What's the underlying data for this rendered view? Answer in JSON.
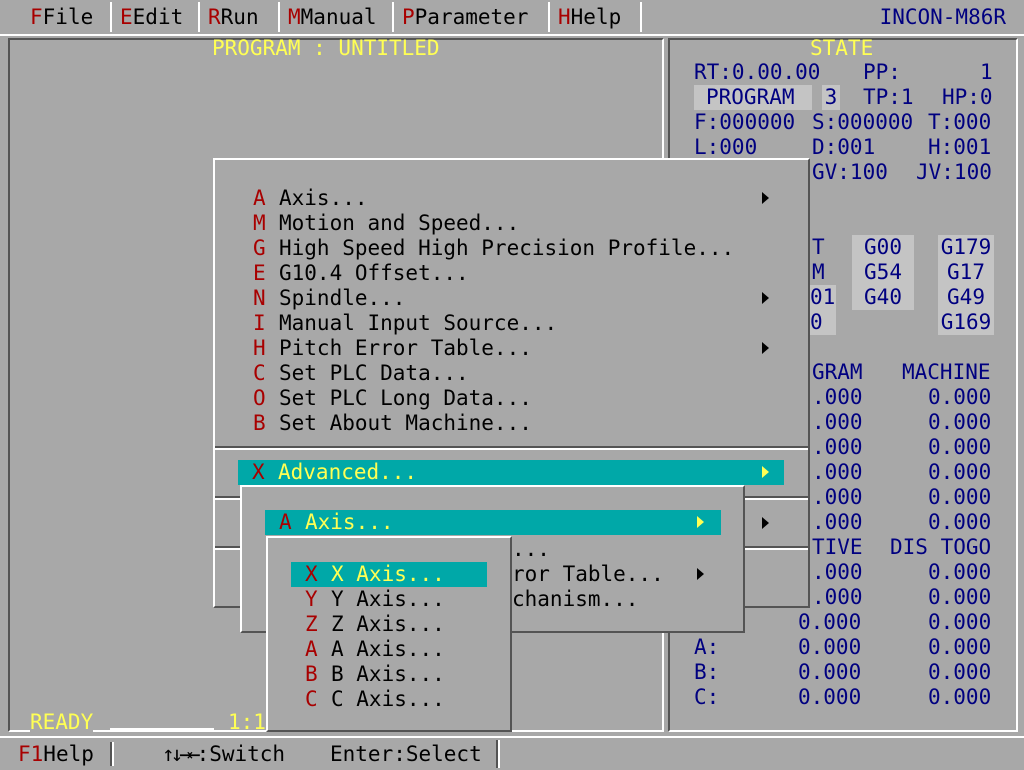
{
  "menubar": {
    "items": [
      {
        "key": "F",
        "label": "File"
      },
      {
        "key": "E",
        "label": "Edit"
      },
      {
        "key": "R",
        "label": "Run"
      },
      {
        "key": "M",
        "label": "Manual"
      },
      {
        "key": "P",
        "label": "Parameter"
      },
      {
        "key": "H",
        "label": "Help"
      }
    ],
    "brand": "INCON-M86R"
  },
  "program": {
    "title": "PROGRAM : UNTITLED",
    "status": "READY",
    "ratio": "1:1"
  },
  "state": {
    "title": "STATE",
    "rt": "RT:0.00.00",
    "pp": "PP:",
    "pp_val": "1",
    "mode": "PROGRAM",
    "mode_num": "3",
    "tp": "TP:1",
    "hp": "HP:0",
    "f": "F:000000",
    "s": "S:000000",
    "t": "T:000",
    "l": "L:000",
    "d": "D:001",
    "h": "H:001",
    "gv": "GV:100",
    "jv": "JV:100",
    "gcodes": [
      [
        "T",
        "G00",
        "G179"
      ],
      [
        "M",
        "G54",
        "G17"
      ],
      [
        "01",
        "G40",
        "G49"
      ],
      [
        "0",
        "",
        "G169"
      ]
    ],
    "coord_headers": [
      "GRAM",
      "MACHINE"
    ],
    "coords1": [
      [
        ".000",
        "0.000"
      ],
      [
        ".000",
        "0.000"
      ],
      [
        ".000",
        "0.000"
      ],
      [
        ".000",
        "0.000"
      ],
      [
        ".000",
        "0.000"
      ],
      [
        ".000",
        "0.000"
      ]
    ],
    "coord_headers2": [
      "TIVE",
      "DIS TOGO"
    ],
    "coords2": [
      {
        "axis": "",
        "rel": ".000",
        "dis": "0.000"
      },
      {
        "axis": "",
        "rel": ".000",
        "dis": "0.000"
      },
      {
        "axis": "",
        "rel": "0.000",
        "dis": "0.000"
      },
      {
        "axis": "A:",
        "rel": "0.000",
        "dis": "0.000"
      },
      {
        "axis": "B:",
        "rel": "0.000",
        "dis": "0.000"
      },
      {
        "axis": "C:",
        "rel": "0.000",
        "dis": "0.000"
      }
    ]
  },
  "menu1": {
    "items": [
      {
        "key": "A",
        "label": "Axis...",
        "sub": true
      },
      {
        "key": "M",
        "label": "Motion and Speed..."
      },
      {
        "key": "G",
        "label": "High Speed High Precision Profile..."
      },
      {
        "key": "E",
        "label": "G10.4 Offset..."
      },
      {
        "key": "N",
        "label": "Spindle...",
        "sub": true
      },
      {
        "key": "I",
        "label": "Manual Input Source..."
      },
      {
        "key": "H",
        "label": "Pitch Error Table...",
        "sub": true
      },
      {
        "key": "C",
        "label": "Set PLC Data..."
      },
      {
        "key": "O",
        "label": "Set PLC Long Data..."
      },
      {
        "key": "B",
        "label": "Set About Machine..."
      }
    ],
    "advanced": {
      "key": "X",
      "label": "Advanced..."
    }
  },
  "menu2": {
    "selected": {
      "key": "A",
      "label": "Axis..."
    },
    "partial": [
      "...",
      "ror Table...",
      "chanism..."
    ]
  },
  "menu3": {
    "items": [
      {
        "key": "X",
        "label": "X Axis..."
      },
      {
        "key": "Y",
        "label": "Y Axis..."
      },
      {
        "key": "Z",
        "label": "Z Axis..."
      },
      {
        "key": "A",
        "label": "A Axis..."
      },
      {
        "key": "B",
        "label": "B Axis..."
      },
      {
        "key": "C",
        "label": "C Axis..."
      }
    ]
  },
  "statusbar": {
    "f1_key": "F1",
    "f1_label": "Help",
    "arrows": "↑↓→←",
    "switch": ":Switch",
    "enter": "Enter:Select"
  }
}
